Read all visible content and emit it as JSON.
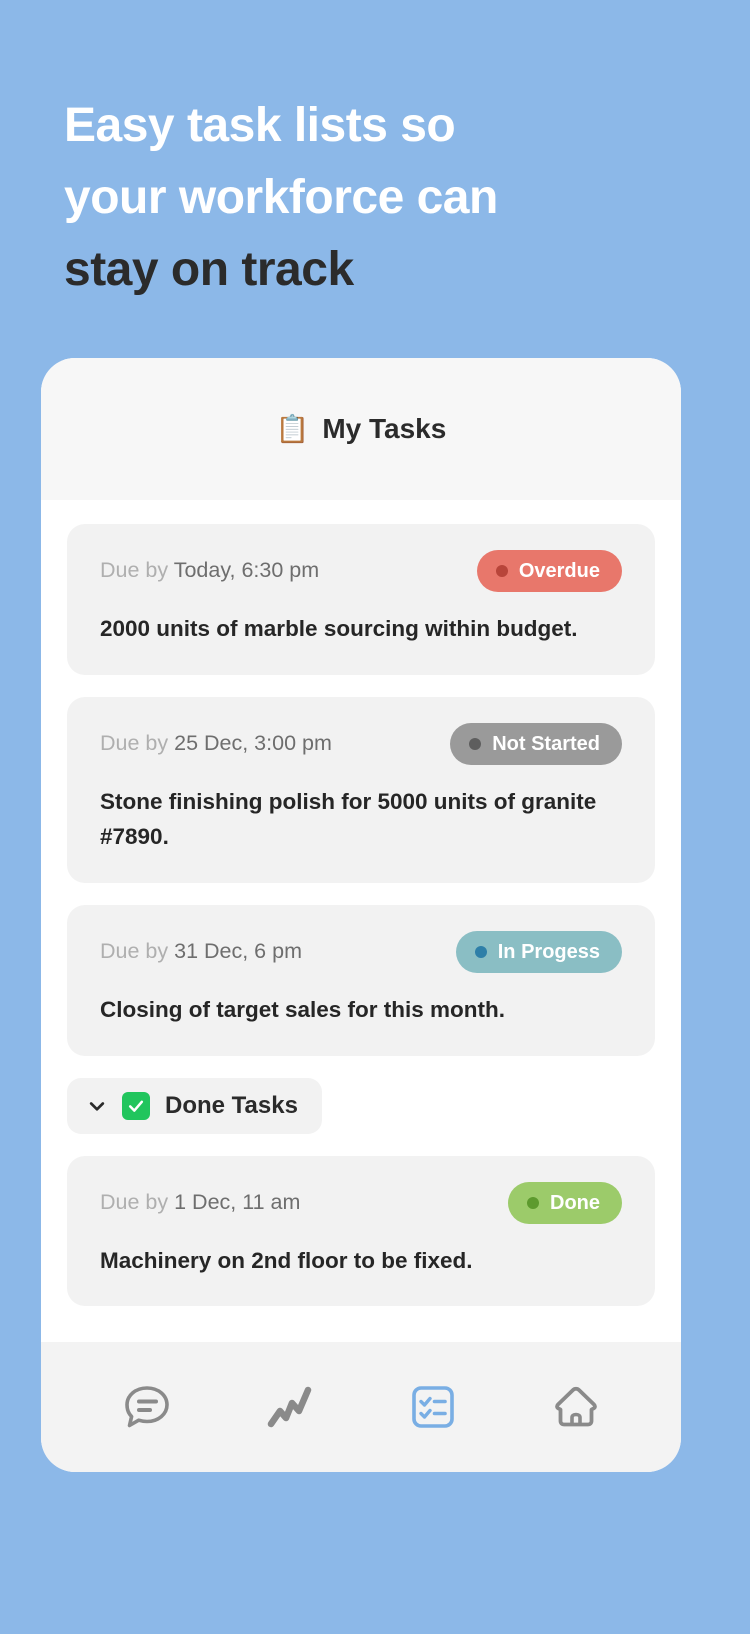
{
  "headline": {
    "lines": [
      {
        "text": "Easy task lists so",
        "tone": "light"
      },
      {
        "text": "your workforce can",
        "tone": "light"
      },
      {
        "text": "stay on track",
        "tone": "dark"
      }
    ]
  },
  "colors": {
    "background": "#8CB8E8",
    "card": "#FFFFFF",
    "task_card": "#F2F2F2",
    "header_bar": "#F7F7F7",
    "overdue": "#E8776B",
    "overdue_dot": "#B8453A",
    "not_started": "#9A9A9A",
    "not_started_dot": "#5E5E5E",
    "in_progress": "#8ABEC4",
    "in_progress_dot": "#2E7FA8",
    "done": "#9CCB6A",
    "done_dot": "#5D9A2E",
    "done_check": "#21C55D",
    "nav_active": "#79AEE4",
    "nav_inactive": "#8A8A8A"
  },
  "phone": {
    "title": "My Tasks",
    "title_icon": "clipboard-emoji",
    "title_emoji": "📋"
  },
  "tasks": [
    {
      "due_label": "Due by ",
      "due_value": "Today, 6:30 pm",
      "status": "Overdue",
      "status_key": "overdue",
      "text": "2000 units of marble sourcing within budget."
    },
    {
      "due_label": "Due by ",
      "due_value": "25 Dec, 3:00 pm",
      "status": "Not Started",
      "status_key": "not_started",
      "text": "Stone finishing polish for 5000 units of granite #7890."
    },
    {
      "due_label": "Due by ",
      "due_value": "31 Dec, 6 pm",
      "status": "In Progess",
      "status_key": "in_progress",
      "text": "Closing of target sales for this month."
    }
  ],
  "done_section": {
    "label": "Done Tasks",
    "expanded": true,
    "chevron_icon": "chevron-down-icon",
    "check_icon": "green-check-icon",
    "tasks": [
      {
        "due_label": "Due by ",
        "due_value": "1 Dec, 11 am",
        "status": "Done",
        "status_key": "done",
        "text": "Machinery on 2nd floor to be fixed."
      }
    ]
  },
  "bottom_nav": {
    "items": [
      {
        "icon": "chat-bubble-icon",
        "active": false
      },
      {
        "icon": "trend-zigzag-icon",
        "active": false
      },
      {
        "icon": "checklist-icon",
        "active": true
      },
      {
        "icon": "home-icon",
        "active": false
      }
    ]
  }
}
